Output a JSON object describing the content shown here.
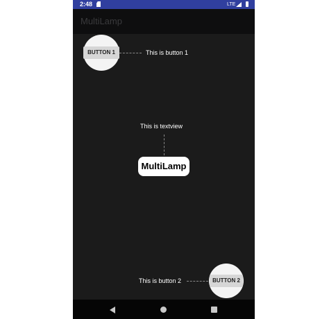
{
  "status_bar": {
    "time": "2:48",
    "network": "LTE",
    "icons": [
      "sd-card-icon",
      "signal-icon",
      "battery-icon"
    ],
    "background": "#303f9f"
  },
  "app_bar": {
    "title": "MultiLamp"
  },
  "content": {
    "button1": {
      "label": "BUTTON 1",
      "hint": "This is button 1"
    },
    "button2": {
      "label": "BUTTON 2",
      "hint": "This is button 2"
    },
    "textview": {
      "label": "MultiLamp",
      "hint": "This is textview"
    }
  },
  "nav_bar": {
    "icons": [
      "back-icon",
      "home-icon",
      "recents-icon"
    ]
  },
  "colors": {
    "screen_background": "#1b1b1b",
    "spotlight": "#f4f4f4",
    "button": "#d6d6d6"
  }
}
